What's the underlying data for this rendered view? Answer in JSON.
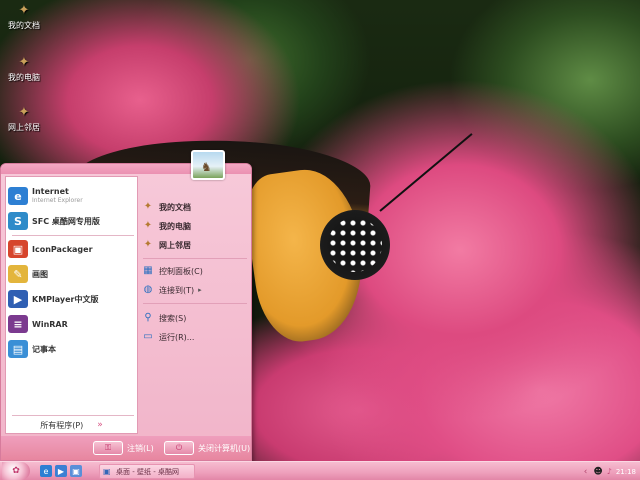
{
  "desktop": {
    "icons": [
      {
        "label": "我的文档",
        "icon": "butterfly-icon"
      },
      {
        "label": "我的电脑",
        "icon": "butterfly-icon"
      },
      {
        "label": "网上邻居",
        "icon": "butterfly-icon"
      }
    ]
  },
  "start_menu": {
    "pinned": [
      {
        "label": "Internet",
        "sub": "Internet Explorer",
        "icon": "internet-explorer-icon",
        "color": "#2d7fd3"
      },
      {
        "label": "SFC 桌酷网专用版",
        "sub": "",
        "icon": "sfc-icon",
        "color": "#2e8bc9"
      }
    ],
    "recent": [
      {
        "label": "IconPackager",
        "icon": "iconpackager-icon",
        "color": "#d6452c"
      },
      {
        "label": "画图",
        "icon": "paint-icon",
        "color": "#e3b53c"
      },
      {
        "label": "KMPlayer中文版",
        "icon": "kmplayer-icon",
        "color": "#2f5fb3"
      },
      {
        "label": "WinRAR",
        "icon": "winrar-icon",
        "color": "#7b3a8f"
      },
      {
        "label": "记事本",
        "icon": "notepad-icon",
        "color": "#3a8fd6"
      }
    ],
    "all_programs": "所有程序(P)",
    "right": [
      {
        "label": "我的文档",
        "bold": true,
        "icon": "butterfly-icon"
      },
      {
        "label": "我的电脑",
        "bold": true,
        "icon": "butterfly-icon"
      },
      {
        "label": "网上邻居",
        "bold": true,
        "icon": "butterfly-icon"
      },
      {
        "label": "控制面板(C)",
        "bold": false,
        "icon": "control-panel-icon"
      },
      {
        "label": "连接到(T)",
        "bold": false,
        "icon": "connect-icon"
      },
      {
        "label": "搜索(S)",
        "bold": false,
        "icon": "search-icon"
      },
      {
        "label": "运行(R)...",
        "bold": false,
        "icon": "run-icon"
      }
    ],
    "logoff_label": "注销(L)",
    "shutdown_label": "关闭计算机(U)"
  },
  "taskbar": {
    "task_label": "桌面 - 壁纸 - 桌酷网",
    "tray_time": "21:18"
  },
  "colors": {
    "accent": "#e7869f",
    "panel": "#f7c9d9"
  }
}
